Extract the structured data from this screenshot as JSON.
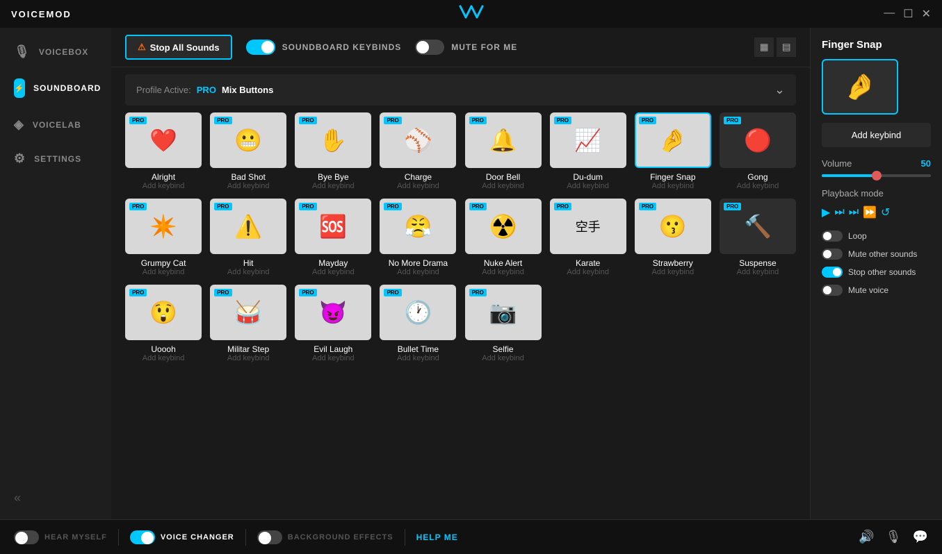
{
  "app": {
    "title": "VOICEMOD",
    "logo": "ω"
  },
  "titlebar": {
    "minimize": "—",
    "maximize": "☐",
    "close": "✕"
  },
  "sidebar": {
    "items": [
      {
        "id": "voicebox",
        "label": "VOICEBOX",
        "icon": "🎙️",
        "active": false
      },
      {
        "id": "soundboard",
        "label": "SOUNDBOARD",
        "icon": "⚡",
        "active": true
      },
      {
        "id": "voicelab",
        "label": "VOICELAB",
        "icon": "🔬",
        "active": false
      },
      {
        "id": "settings",
        "label": "SETTINGS",
        "icon": "⚙️",
        "active": false
      }
    ],
    "collapse_icon": "«"
  },
  "toolbar": {
    "stop_all_label": "Stop All Sounds",
    "keybinds_label": "SOUNDBOARD KEYBINDS",
    "mute_label": "MUTE FOR ME",
    "keybinds_on": true,
    "mute_on": false
  },
  "profile": {
    "label": "Profile Active:",
    "tier": "PRO",
    "name": "Mix Buttons"
  },
  "sounds": [
    {
      "id": "alright",
      "name": "Alright",
      "keybind": "Add keybind",
      "emoji": "❤️",
      "bg": "light",
      "selected": false
    },
    {
      "id": "bad-shot",
      "name": "Bad Shot",
      "keybind": "Add keybind",
      "emoji": "😬",
      "bg": "light",
      "selected": false
    },
    {
      "id": "bye-bye",
      "name": "Bye Bye",
      "keybind": "Add keybind",
      "emoji": "✋",
      "bg": "light",
      "selected": false
    },
    {
      "id": "charge",
      "name": "Charge",
      "keybind": "Add keybind",
      "emoji": "⚾",
      "bg": "light",
      "selected": false
    },
    {
      "id": "door-bell",
      "name": "Door Bell",
      "keybind": "Add keybind",
      "emoji": "🔔",
      "bg": "light",
      "selected": false
    },
    {
      "id": "du-dum",
      "name": "Du-dum",
      "keybind": "Add keybind",
      "emoji": "📈",
      "bg": "light",
      "selected": false
    },
    {
      "id": "finger-snap",
      "name": "Finger Snap",
      "keybind": "Add keybind",
      "emoji": "🤌",
      "bg": "light",
      "selected": true
    },
    {
      "id": "gong",
      "name": "Gong",
      "keybind": "Add keybind",
      "emoji": "🔴",
      "bg": "dark",
      "selected": false
    },
    {
      "id": "grumpy-cat",
      "name": "Grumpy Cat",
      "keybind": "Add keybind",
      "emoji": "✴️",
      "bg": "light",
      "selected": false
    },
    {
      "id": "hit",
      "name": "Hit",
      "keybind": "Add keybind",
      "emoji": "⚠️",
      "bg": "light",
      "selected": false
    },
    {
      "id": "mayday",
      "name": "Mayday",
      "keybind": "Add keybind",
      "emoji": "🆘",
      "bg": "light",
      "selected": false
    },
    {
      "id": "no-more-drama",
      "name": "No More Drama",
      "keybind": "Add keybind",
      "emoji": "😤",
      "bg": "light",
      "selected": false
    },
    {
      "id": "nuke-alert",
      "name": "Nuke Alert",
      "keybind": "Add keybind",
      "emoji": "☢️",
      "bg": "light",
      "selected": false
    },
    {
      "id": "karate",
      "name": "Karate",
      "keybind": "Add keybind",
      "emoji": "空手",
      "bg": "light",
      "selected": false
    },
    {
      "id": "strawberry",
      "name": "Strawberry",
      "keybind": "Add keybind",
      "emoji": "😗",
      "bg": "light",
      "selected": false
    },
    {
      "id": "suspense",
      "name": "Suspense",
      "keybind": "Add keybind",
      "emoji": "🔨",
      "bg": "dark",
      "selected": false
    },
    {
      "id": "uoooh",
      "name": "Uoooh",
      "keybind": "Add keybind",
      "emoji": "😲",
      "bg": "light",
      "selected": false
    },
    {
      "id": "miltar-step",
      "name": "Militar Step",
      "keybind": "Add keybind",
      "emoji": "🥁",
      "bg": "light",
      "selected": false
    },
    {
      "id": "evil-laugh",
      "name": "Evil Laugh",
      "keybind": "Add keybind",
      "emoji": "😈",
      "bg": "light",
      "selected": false
    },
    {
      "id": "bullet-time",
      "name": "Bullet Time",
      "keybind": "Add keybind",
      "emoji": "🕐",
      "bg": "light",
      "selected": false
    },
    {
      "id": "selfie",
      "name": "Selfie",
      "keybind": "Add keybind",
      "emoji": "📷",
      "bg": "light",
      "selected": false
    }
  ],
  "right_panel": {
    "title": "Finger Snap",
    "thumb_emoji": "🤌",
    "add_keybind": "Add keybind",
    "volume_label": "Volume",
    "volume_value": "50",
    "playback_label": "Playback mode",
    "playback_btns": [
      "▶",
      "⏭",
      "⏭",
      "⏩",
      "⟲"
    ],
    "options": [
      {
        "id": "loop",
        "label": "Loop",
        "on": false
      },
      {
        "id": "mute-other",
        "label": "Mute other sounds",
        "on": false
      },
      {
        "id": "stop-other",
        "label": "Stop other sounds",
        "on": true
      },
      {
        "id": "mute-voice",
        "label": "Mute voice",
        "on": false
      }
    ]
  },
  "bottom_bar": {
    "hear_myself_label": "HEAR MYSELF",
    "hear_myself_on": false,
    "voice_changer_label": "VOICE CHANGER",
    "voice_changer_on": true,
    "background_effects_label": "BACKGROUND EFFECTS",
    "background_effects_on": false,
    "help_label": "HELP ME"
  }
}
